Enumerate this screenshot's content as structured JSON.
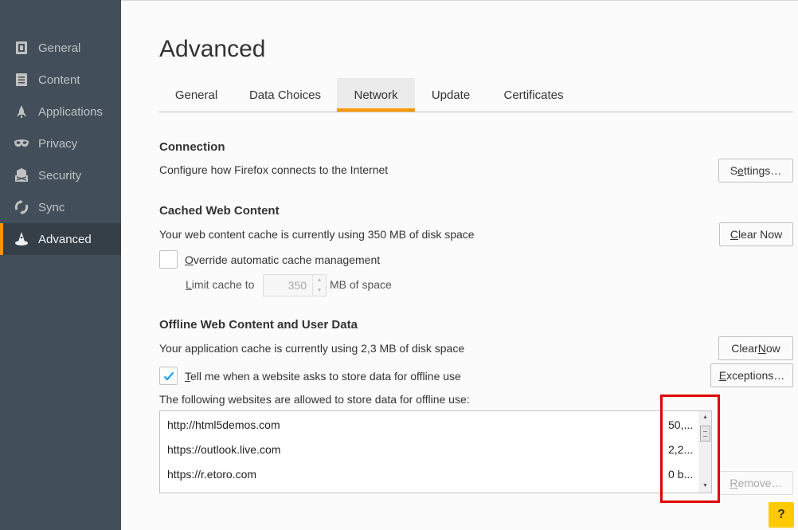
{
  "sidebar": {
    "items": [
      {
        "label": "General",
        "icon": "general-icon",
        "active": false
      },
      {
        "label": "Content",
        "icon": "content-icon",
        "active": false
      },
      {
        "label": "Applications",
        "icon": "applications-icon",
        "active": false
      },
      {
        "label": "Privacy",
        "icon": "privacy-mask-icon",
        "active": false
      },
      {
        "label": "Security",
        "icon": "security-icon",
        "active": false
      },
      {
        "label": "Sync",
        "icon": "sync-icon",
        "active": false
      },
      {
        "label": "Advanced",
        "icon": "advanced-wizard-icon",
        "active": true
      }
    ]
  },
  "page": {
    "title": "Advanced"
  },
  "tabs": [
    {
      "label": "General"
    },
    {
      "label": "Data Choices"
    },
    {
      "label": "Network",
      "active": true
    },
    {
      "label": "Update"
    },
    {
      "label": "Certificates"
    }
  ],
  "connection": {
    "heading": "Connection",
    "description": "Configure how Firefox connects to the Internet",
    "settings_pre": "S",
    "settings_ul": "e",
    "settings_post": "ttings…"
  },
  "cache": {
    "heading": "Cached Web Content",
    "description": "Your web content cache is currently using 350 MB of disk space",
    "clear_pre": "",
    "clear_ul": "C",
    "clear_post": "lear Now",
    "override_ul": "O",
    "override_post": "verride automatic cache management",
    "override_checked": false,
    "limit_ul": "L",
    "limit_post": "imit cache to",
    "limit_value": "350",
    "limit_unit": "MB of space"
  },
  "offline": {
    "heading": "Offline Web Content and User Data",
    "description": "Your application cache is currently using 2,3 MB of disk space",
    "clear_pre": "Clear ",
    "clear_ul": "N",
    "clear_post": "ow",
    "tell_ul": "T",
    "tell_post": "ell me when a website asks to store data for offline use",
    "tell_checked": true,
    "exceptions_pre": "",
    "exceptions_ul": "E",
    "exceptions_post": "xceptions…",
    "allowed_label": "The following websites are allowed to store data for offline use:",
    "sites": [
      {
        "url": "http://html5demos.com",
        "size": "50,..."
      },
      {
        "url": "https://outlook.live.com",
        "size": "2,2..."
      },
      {
        "url": "https://r.etoro.com",
        "size": "0 b..."
      }
    ],
    "remove_ul": "R",
    "remove_post": "emove…"
  },
  "help": {
    "label": "?"
  },
  "colors": {
    "accent": "#ff9500",
    "sidebar_bg": "#424f5a",
    "highlight_box": "#e00000",
    "help_bg": "#ffcb00"
  }
}
